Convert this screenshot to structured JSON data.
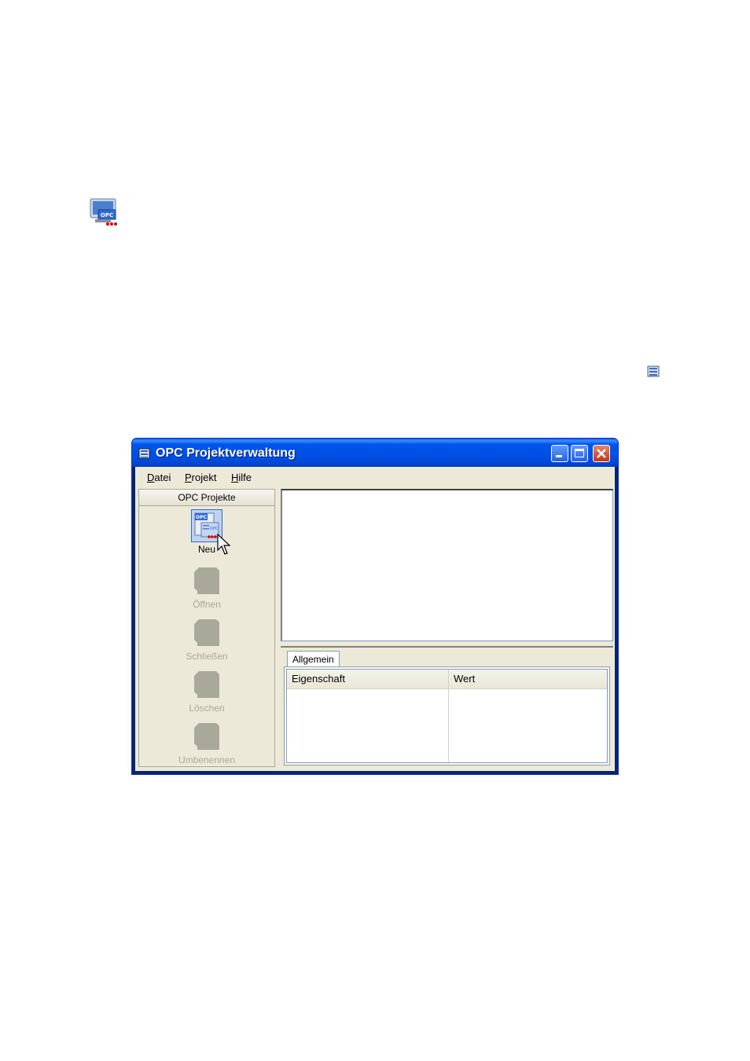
{
  "window": {
    "title": "OPC Projektverwaltung"
  },
  "menu": {
    "items": [
      {
        "mnemonic": "D",
        "rest": "atei"
      },
      {
        "mnemonic": "P",
        "rest": "rojekt"
      },
      {
        "mnemonic": "H",
        "rest": "ilfe"
      }
    ]
  },
  "left_panel": {
    "header": "OPC Projekte",
    "tools": [
      {
        "label": "Neu",
        "enabled": true,
        "icon": "new-opc-project-icon"
      },
      {
        "label": "Öffnen",
        "enabled": false,
        "icon": "open-project-icon"
      },
      {
        "label": "Schließen",
        "enabled": false,
        "icon": "close-project-icon"
      },
      {
        "label": "Löschen",
        "enabled": false,
        "icon": "delete-project-icon"
      },
      {
        "label": "Umbenennen",
        "enabled": false,
        "icon": "rename-project-icon"
      }
    ]
  },
  "properties": {
    "tab": "Allgemein",
    "columns": [
      "Eigenschaft",
      "Wert"
    ]
  },
  "colors": {
    "titlebar": "#0055ea",
    "client_bg": "#ece9d8",
    "disabled_text": "#aca899"
  }
}
